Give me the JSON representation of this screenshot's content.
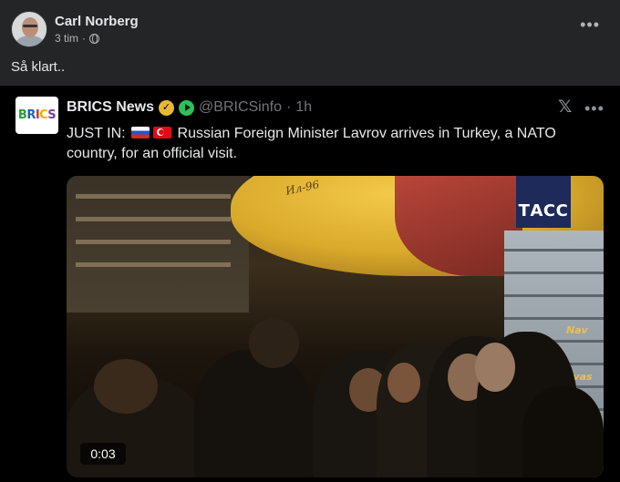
{
  "post": {
    "author": "Carl Norberg",
    "time": "3 tim",
    "separator": "·",
    "text": "Så klart..",
    "more_icon": "more-horizontal-icon",
    "privacy_icon": "globe-icon"
  },
  "tweet": {
    "avatar_text": "BRICS",
    "name": "BRICS News",
    "handle": "@BRICSinfo",
    "separator": "·",
    "time": "1h",
    "prefix": "JUST IN:",
    "body": "Russian Foreign Minister Lavrov arrives in Turkey, a NATO country, for an official visit.",
    "flags": [
      "russia-flag-icon",
      "turkey-flag-icon"
    ],
    "verified_icon": "verified-badge-icon",
    "x_logo": "x-logo-icon",
    "more_icon": "more-horizontal-icon"
  },
  "video": {
    "watermark": "ТАСС",
    "plane_label": "Ил-96",
    "stair_text_1": "Nav",
    "stair_text_2": "avas",
    "duration": "0:03"
  },
  "colors": {
    "background": "#242526",
    "tweet_background": "#000000",
    "verified": "#e8b92f",
    "tass_blue": "#1d2a5a"
  }
}
